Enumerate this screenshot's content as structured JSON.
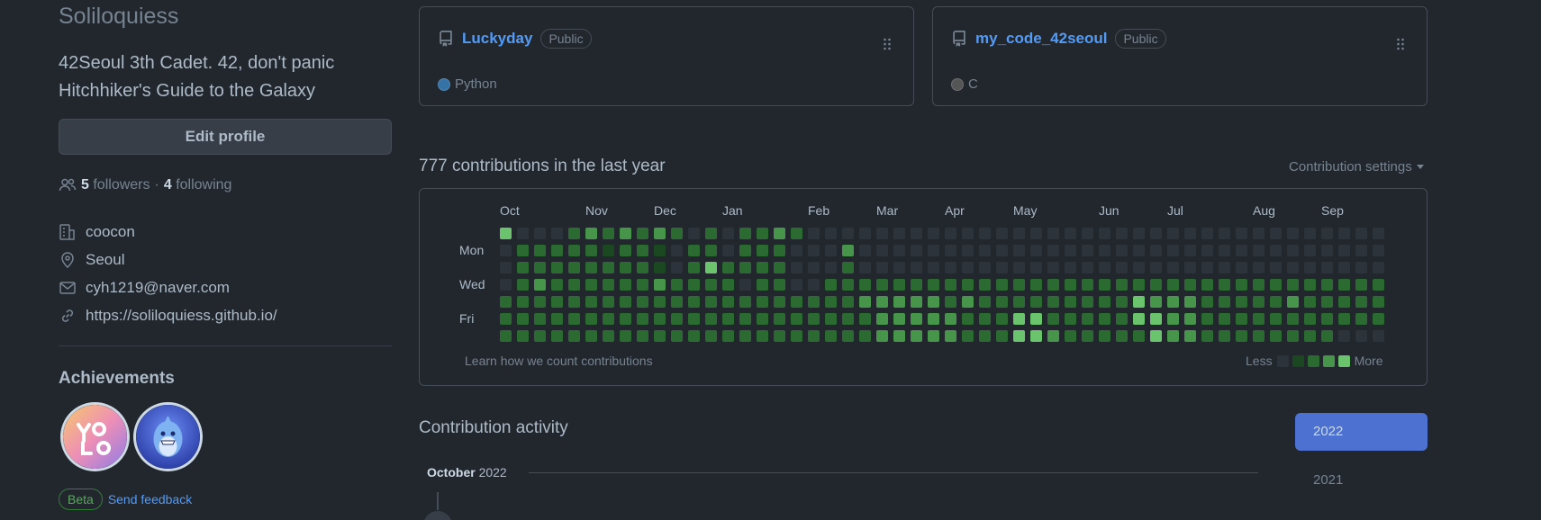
{
  "profile": {
    "username": "Soliloquiess",
    "bio_line1": "42Seoul 3th Cadet. 42, don't panic",
    "bio_line2": "Hitchhiker's Guide to the Galaxy",
    "edit_button": "Edit profile",
    "followers_count": "5",
    "followers_label": "followers",
    "separator": "·",
    "following_count": "4",
    "following_label": "following",
    "company": "coocon",
    "location": "Seoul",
    "email": "cyh1219@naver.com",
    "website": "https://soliloquiess.github.io/",
    "achievements_title": "Achievements",
    "beta_label": "Beta",
    "feedback_link": "Send feedback"
  },
  "repos": [
    {
      "name": "Luckyday",
      "visibility": "Public",
      "language": "Python",
      "lang_color": "#3572A5"
    },
    {
      "name": "my_code_42seoul",
      "visibility": "Public",
      "language": "C",
      "lang_color": "#555555"
    }
  ],
  "contributions": {
    "title": "777 contributions in the last year",
    "settings_label": "Contribution settings",
    "months": [
      "Oct",
      "Nov",
      "Dec",
      "Jan",
      "Feb",
      "Mar",
      "Apr",
      "May",
      "Jun",
      "Jul",
      "Aug",
      "Sep"
    ],
    "day_labels": [
      "Mon",
      "Wed",
      "Fri"
    ],
    "learn_link": "Learn how we count contributions",
    "legend_less": "Less",
    "legend_more": "More",
    "level_colors": [
      "#2d333b",
      "#1b4721",
      "#2b6a30",
      "#46954a",
      "#6bc46d"
    ],
    "grid": [
      "4000232323202022320000000000000000000000000000000000",
      "0222221221022022200030000000000000000000000000000000",
      "0222222221024222200020000000000000000000000000000000",
      "0232222223222202200222222222222222222222222222222222",
      "2222222222222222222223333323222222222433322222322222",
      "2222222222222222222222333332224422222443322222222222",
      "2222222222222222222222333332224432222243322222222000"
    ]
  },
  "activity": {
    "title": "Contribution activity",
    "year_selected": "2022",
    "year_other": "2021",
    "month_name": "October",
    "month_year": "2022"
  }
}
